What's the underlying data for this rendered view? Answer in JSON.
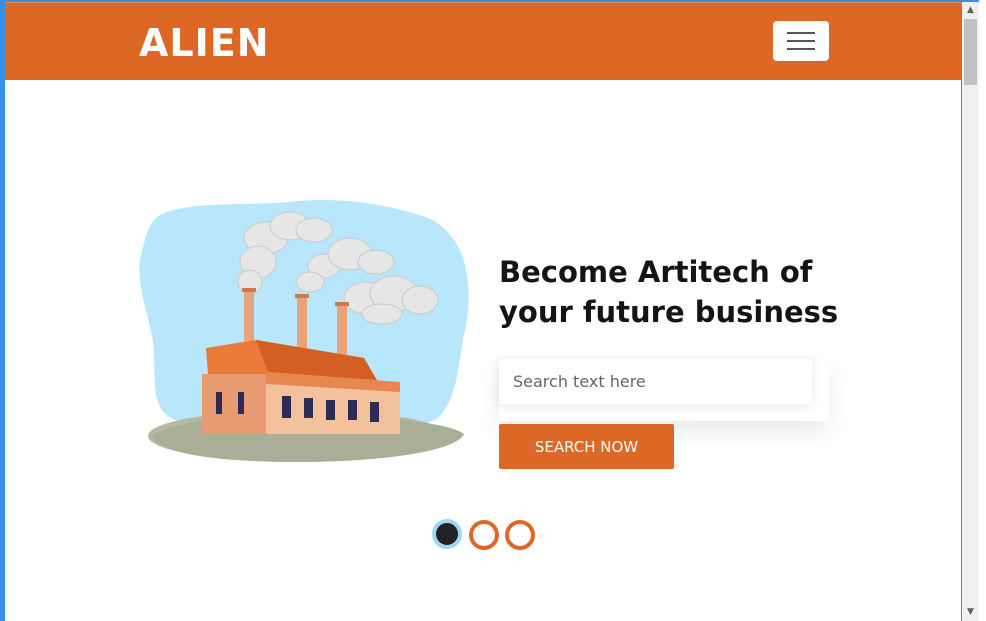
{
  "navbar": {
    "brand": "ALIEN",
    "menu_toggle_icon": "hamburger-icon"
  },
  "hero": {
    "headline_line1": "Become Artitech of",
    "headline_line2": "your future business",
    "search_placeholder": "Search text here",
    "search_value": "",
    "search_button_label": "SEARCH NOW",
    "illustration": "factory-illustration"
  },
  "carousel": {
    "slide_count": 3,
    "active_index": 0
  },
  "colors": {
    "accent": "#dd6826",
    "sky": "#b8e6fb",
    "active_dot_ring": "#9fd7f7"
  }
}
